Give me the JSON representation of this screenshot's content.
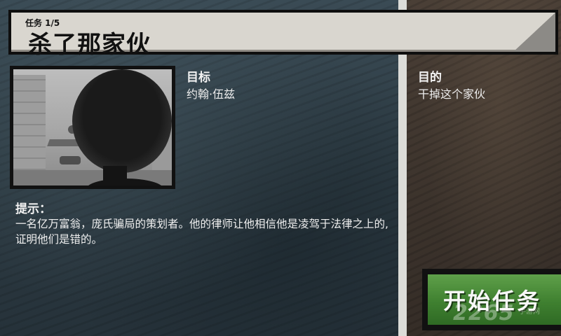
{
  "header": {
    "mission_count": "任务 1/5",
    "mission_title": "杀了那家伙"
  },
  "target": {
    "label": "目标",
    "name": "约翰·伍兹"
  },
  "hint": {
    "label": "提示：",
    "text": "一名亿万富翁，庞氏骗局的策划者。他的律师让他相信他是凌驾于法律之上的,证明他们是错的。"
  },
  "goal": {
    "label": "目的",
    "text": "干掉这个家伙"
  },
  "start_button": {
    "label": "开始任务"
  },
  "watermark": {
    "text": "2265",
    "sub": "手游网"
  },
  "colors": {
    "left_panel": "#2f3d45",
    "right_panel": "#3c332c",
    "button_green": "#3f8030",
    "banner": "#d9d6cf"
  }
}
